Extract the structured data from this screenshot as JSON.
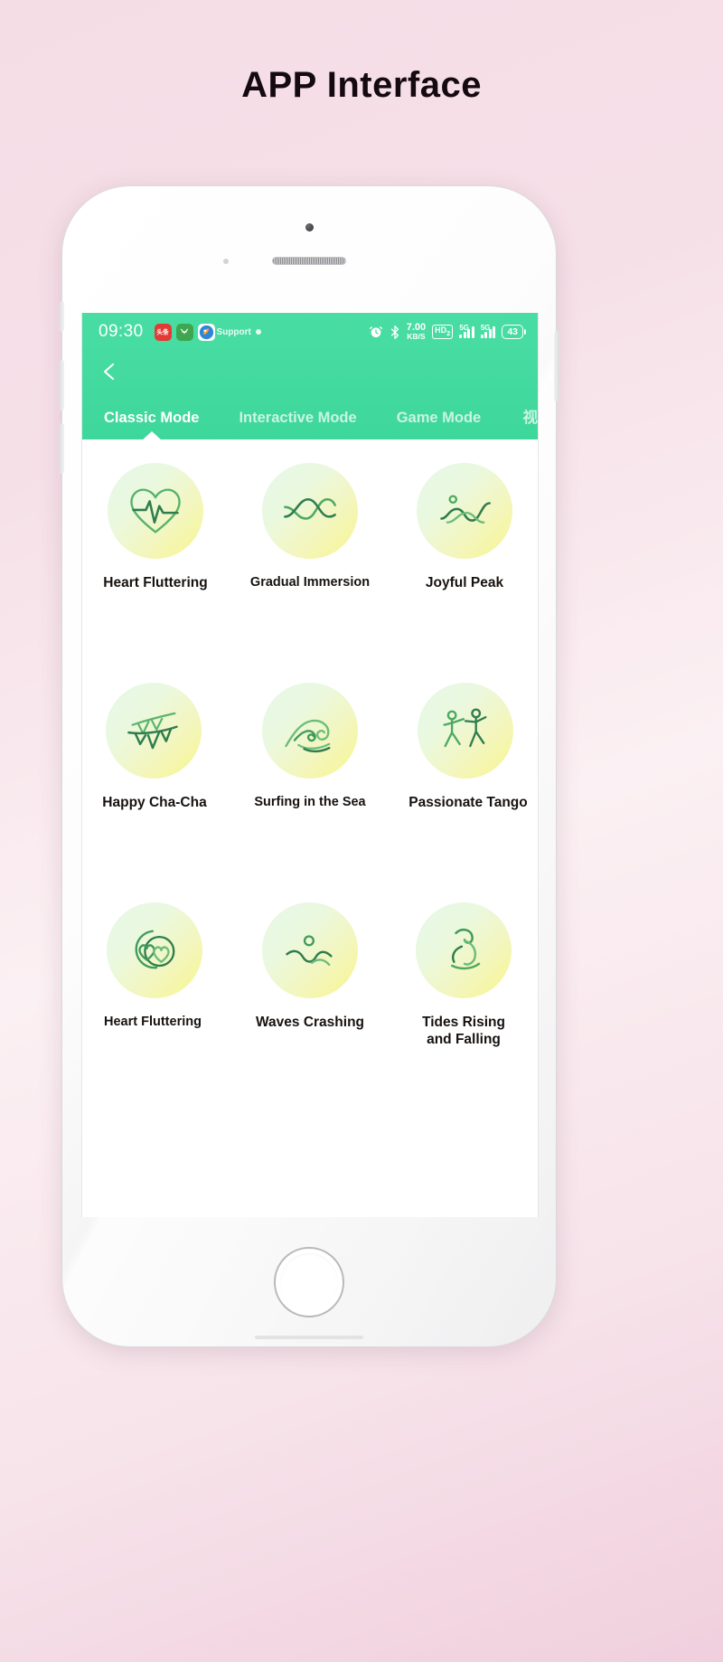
{
  "page": {
    "title": "APP Interface",
    "background_top": "#f5dde6",
    "background_bottom": "#f0cfdd"
  },
  "phone": {
    "frame_color": "#ffffff",
    "accent_color": "#3ed79b"
  },
  "status_bar": {
    "time": "09:30",
    "notif_icons": [
      {
        "name": "toutiao-icon",
        "label": "头条",
        "style": "red"
      },
      {
        "name": "wechat-pay-icon",
        "label": "‿",
        "style": "green"
      },
      {
        "name": "support-app-icon",
        "label": "",
        "style": "white"
      }
    ],
    "support_label": "Support",
    "alarm_icon": "alarm-icon",
    "bluetooth_icon": "bluetooth-icon",
    "network_speed": "7.00",
    "network_speed_unit": "KB/S",
    "hd_badge": "HD",
    "hd_badge_sub": "2",
    "signal_1_label": "5G",
    "signal_2_label": "5G",
    "battery_level": "43"
  },
  "header": {
    "back_icon": "back-chevron-icon",
    "tabs": [
      {
        "label": "Classic Mode",
        "active": true
      },
      {
        "label": "Interactive Mode",
        "active": false
      },
      {
        "label": "Game Mode",
        "active": false
      }
    ],
    "tab_overflow_label": "视"
  },
  "grid": {
    "rows": [
      [
        {
          "label": "Heart Fluttering",
          "icon": "heartbeat-icon"
        },
        {
          "label": "Gradual Immersion",
          "icon": "crossing-waves-icon"
        },
        {
          "label": "Joyful Peak",
          "icon": "peak-wave-icon"
        }
      ],
      [
        {
          "label": "Happy Cha-Cha",
          "icon": "bunting-flags-icon"
        },
        {
          "label": "Surfing in the Sea",
          "icon": "ocean-wave-icon"
        },
        {
          "label": "Passionate Tango",
          "icon": "dancing-couple-icon"
        }
      ],
      [
        {
          "label": "Heart Fluttering",
          "icon": "two-hearts-icon"
        },
        {
          "label": "Waves Crashing",
          "icon": "swimmer-icon"
        },
        {
          "label": "Tides Rising and Falling",
          "icon": "runner-icon"
        }
      ]
    ]
  }
}
